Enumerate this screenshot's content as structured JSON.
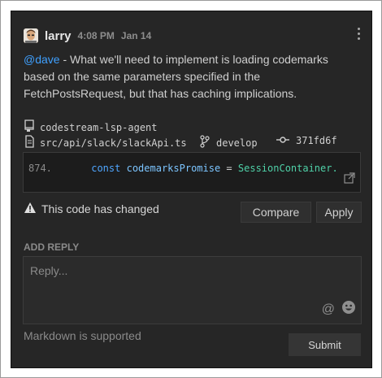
{
  "post": {
    "author": "larry",
    "time": "4:08 PM",
    "date": "Jan 14",
    "mention": "@dave",
    "text": " - What we'll need to implement is loading codemarks based on the same parameters specified in the FetchPostsRequest, but that has caching implications."
  },
  "code": {
    "repo": "codestream-lsp-agent",
    "file": "src/api/slack/slackApi.ts",
    "branch": "develop",
    "commit": "371fd6f",
    "line_number": "874.",
    "line_tokens": {
      "keyword": "const",
      "identifier": "codemarksPromise",
      "operator": "=",
      "class_name": "SessionContainer."
    }
  },
  "status": {
    "changed_text": "This code has changed"
  },
  "buttons": {
    "compare": "Compare",
    "apply": "Apply",
    "submit": "Submit"
  },
  "reply": {
    "section_label": "ADD REPLY",
    "placeholder": "Reply...",
    "markdown_hint": "Markdown is supported",
    "mention_icon": "@"
  },
  "colors": {
    "panel_bg": "#262626",
    "mention": "#3fa0ff",
    "keyword": "#4fa6ff",
    "class_name": "#4fd1a8"
  }
}
